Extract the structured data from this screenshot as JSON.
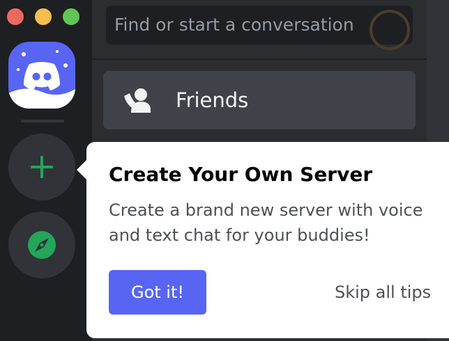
{
  "window": {
    "traffic_lights": [
      "close",
      "minimize",
      "zoom"
    ]
  },
  "server_rail": {
    "home_icon": "discord-logo-icon",
    "add_server_icon": "plus-icon",
    "explore_icon": "compass-icon"
  },
  "search": {
    "placeholder": "Find or start a conversation"
  },
  "nav": {
    "friends_label": "Friends",
    "friends_icon": "friends-icon"
  },
  "tooltip": {
    "title": "Create Your Own Server",
    "body": "Create a brand new server with voice and text chat for your buddies!",
    "primary_button": "Got it!",
    "secondary_button": "Skip all tips"
  },
  "colors": {
    "blurple": "#5865f2",
    "green": "#23a55a",
    "rail_bg": "#1e1f22",
    "channel_bg": "#2b2d31"
  }
}
